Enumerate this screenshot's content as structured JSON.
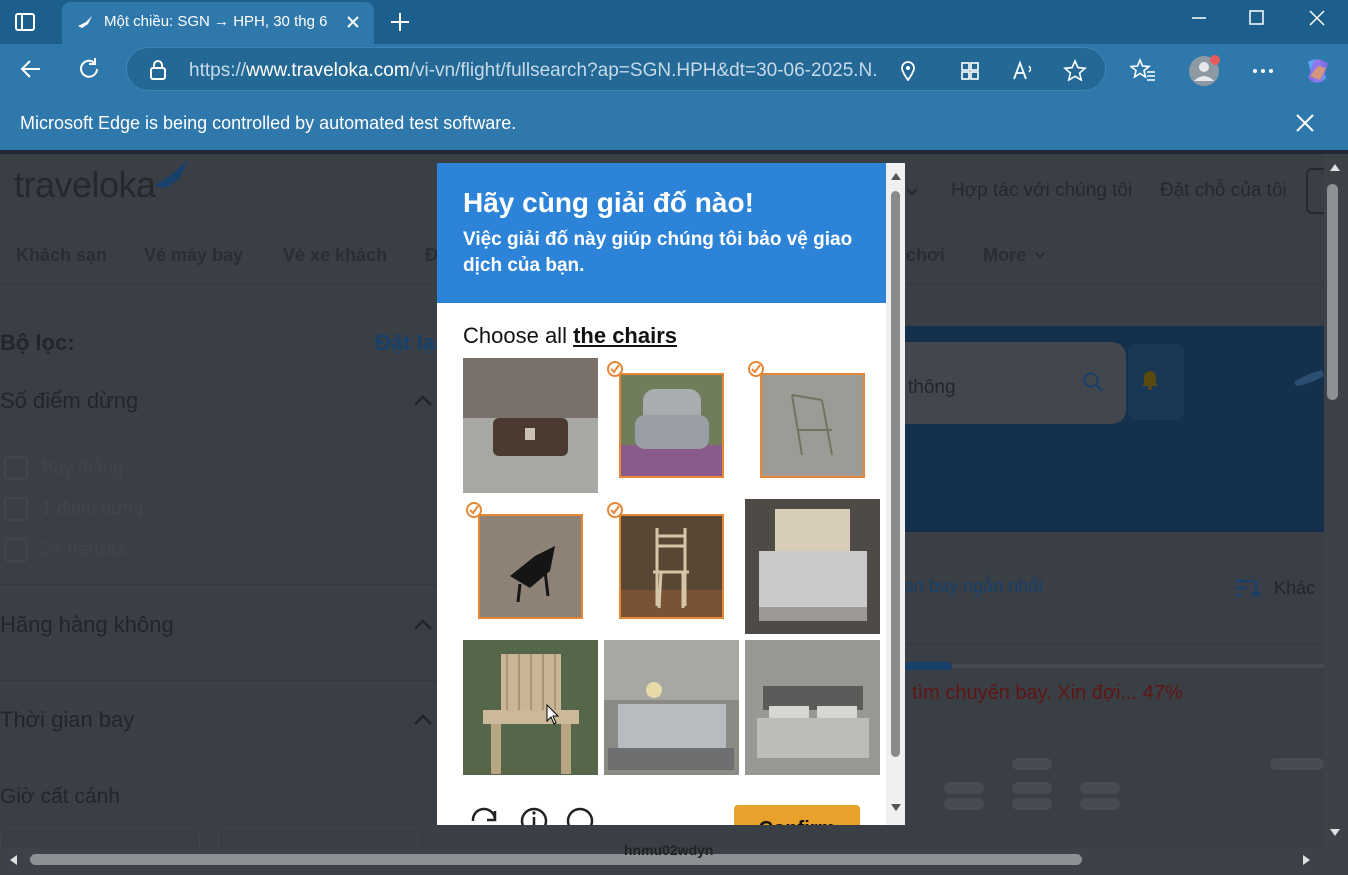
{
  "browser": {
    "tab_title": "Một chiều: SGN → HPH, 30 thg 6",
    "url_prefix": "https://",
    "url_domain": "www.traveloka.com",
    "url_path": "/vi-vn/flight/fullsearch?ap=SGN.HPH&dt=30-06-2025.N...",
    "automation_notice": "Microsoft Edge is being controlled by automated test software."
  },
  "site": {
    "logo": "traveloka",
    "header_links": [
      "Hợp tác với chúng tôi",
      "Đặt chỗ của tôi"
    ],
    "menu": [
      "Khách sạn",
      "Vé máy bay",
      "Vé xe khách",
      "Đ",
      "chơi",
      "More"
    ]
  },
  "filters": {
    "title": "Bộ lọc:",
    "reset": "Đặt lại",
    "stops_title": "Số điểm dừng",
    "stops": [
      "Bay thẳng",
      "1 điểm dừng",
      "2+ transits"
    ],
    "airlines_title": "Hãng hàng không",
    "flight_time_title": "Thời gian bay",
    "departure_title": "Giờ cất cánh"
  },
  "results": {
    "search_placeholder": "thông",
    "sort_label": "an bay ngắn nhất",
    "other_label": "Khác",
    "loading_text": "tìm chuyến bay. Xin đợi... 47%",
    "progress_percent": 47
  },
  "captcha": {
    "title": "Hãy cùng giải đố nào!",
    "subtitle": "Việc giải đố này giúp chúng tôi bảo vệ giao dịch của bạn.",
    "prompt_prefix": "Choose all",
    "prompt_target": "the chairs",
    "tiles": [
      {
        "name": "tile-bag",
        "selected": false
      },
      {
        "name": "tile-armchair",
        "selected": true
      },
      {
        "name": "tile-wire-chair",
        "selected": true
      },
      {
        "name": "tile-black-chair",
        "selected": true
      },
      {
        "name": "tile-wooden-chair",
        "selected": true
      },
      {
        "name": "tile-bed-1",
        "selected": false
      },
      {
        "name": "tile-adirondack-chair",
        "selected": false
      },
      {
        "name": "tile-bed-2",
        "selected": false
      },
      {
        "name": "tile-bed-3",
        "selected": false
      }
    ],
    "confirm_label": "Confirm",
    "below_text": "hnmu02wdyn"
  },
  "colors": {
    "accent": "#2c83d8",
    "confirm": "#e8a12a",
    "selected_border": "#e68736",
    "edge_frame": "#2f78ac"
  }
}
